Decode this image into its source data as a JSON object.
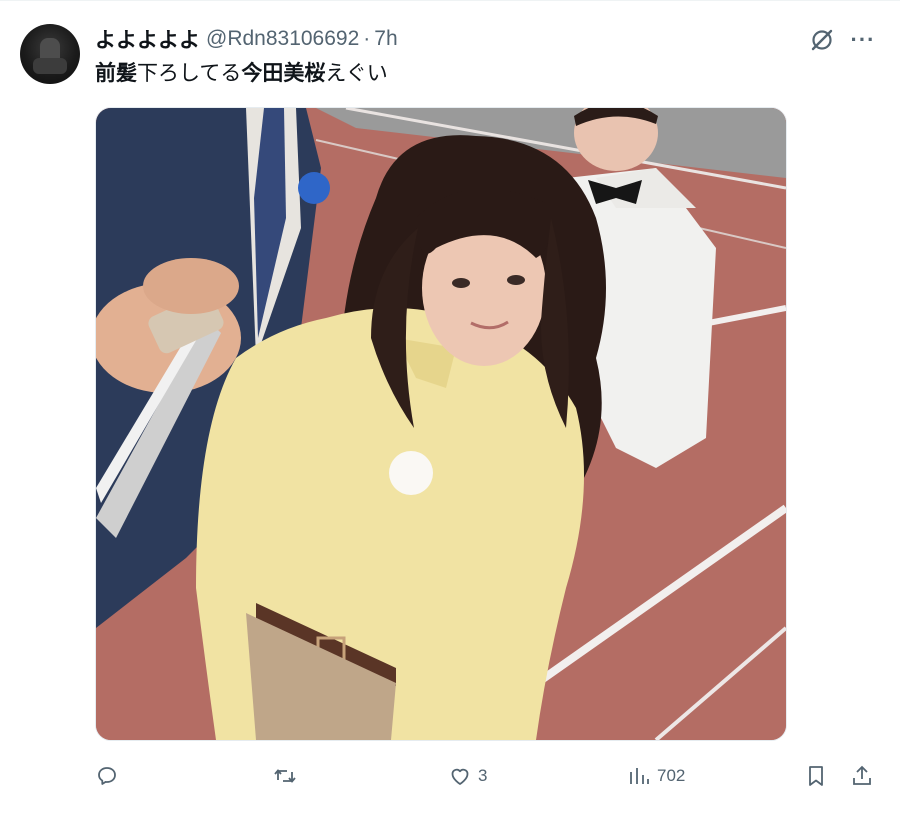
{
  "author": {
    "display_name": "よよよよよ",
    "handle": "@Rdn83106692",
    "separator": "·",
    "time_ago": "7h"
  },
  "tweet": {
    "segments": [
      {
        "text": "前髪",
        "bold": true
      },
      {
        "text": "下ろしてる",
        "bold": false
      },
      {
        "text": "今田美桜",
        "bold": true
      },
      {
        "text": "えぐい",
        "bold": false
      }
    ]
  },
  "header_icons": {
    "grok": "grok-icon",
    "more_label": "···"
  },
  "actions": {
    "reply": {
      "icon": "reply-icon",
      "count": ""
    },
    "repost": {
      "icon": "repost-icon",
      "count": ""
    },
    "like": {
      "icon": "heart-icon",
      "count": "3"
    },
    "views": {
      "icon": "views-icon",
      "count": "702"
    },
    "bookmark": {
      "icon": "bookmark-icon"
    },
    "share": {
      "icon": "share-icon"
    }
  },
  "colors": {
    "text_primary": "#0f1419",
    "text_secondary": "#536471",
    "track": "#b86b63",
    "blouse": "#f1e2a0"
  }
}
